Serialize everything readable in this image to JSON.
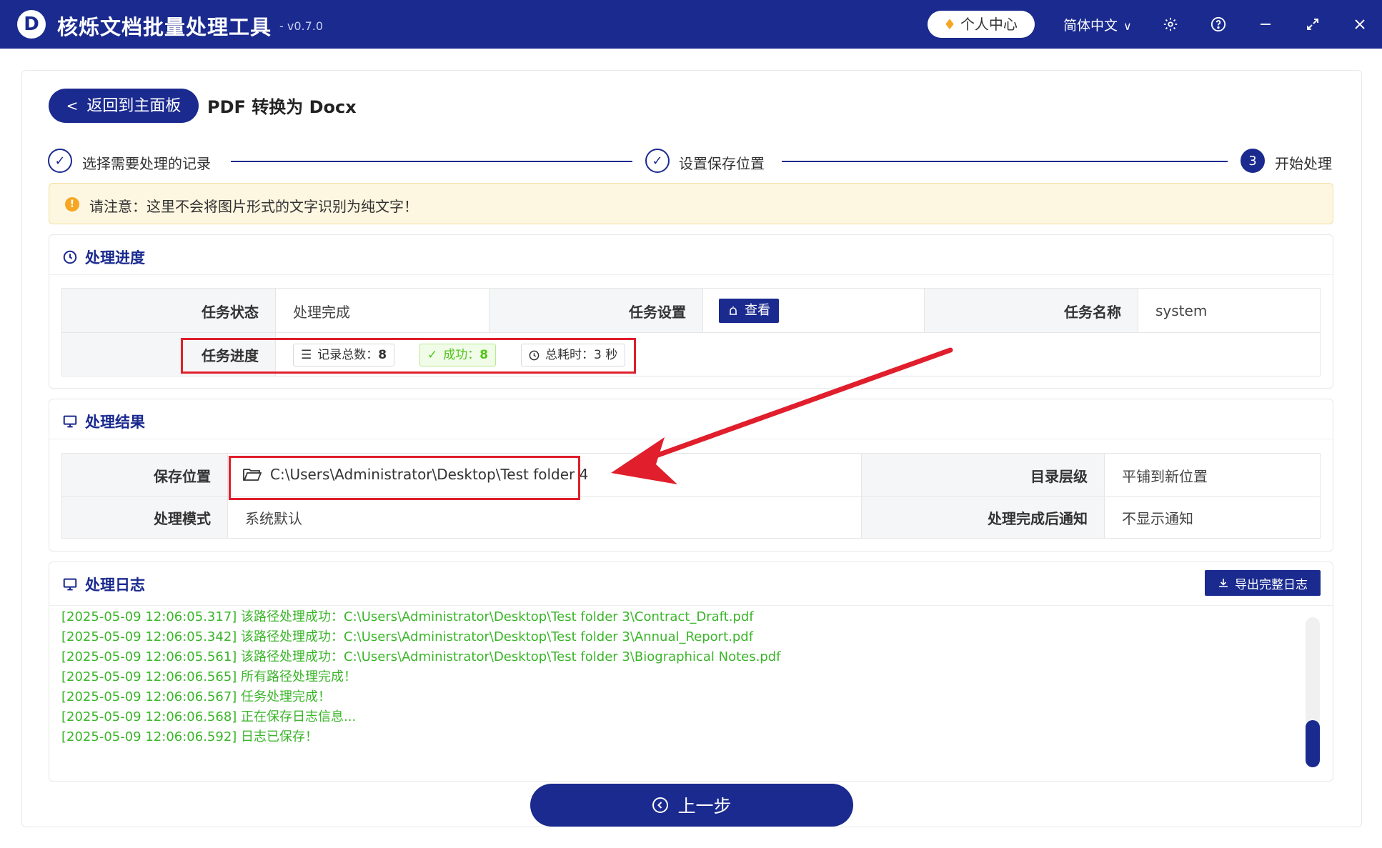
{
  "app": {
    "logo_letter": "D",
    "title": "核烁文档批量处理工具",
    "version": "- v0.7.0",
    "user_center": "个人中心",
    "language": "简体中文"
  },
  "page": {
    "back_label": "返回到主面板",
    "title": "PDF 转换为 Docx"
  },
  "steps": [
    {
      "label": "选择需要处理的记录",
      "state": "done"
    },
    {
      "label": "设置保存位置",
      "state": "done"
    },
    {
      "label": "开始处理",
      "number": "3",
      "state": "active"
    }
  ],
  "notice": {
    "icon": "!",
    "text": "请注意：这里不会将图片形式的文字识别为纯文字！"
  },
  "progress": {
    "title": "处理进度",
    "status_label": "任务状态",
    "status_value": "处理完成",
    "settings_label": "任务设置",
    "view_button": "查看",
    "name_label": "任务名称",
    "name_value": "system",
    "progress_label": "任务进度",
    "total_label": "记录总数：",
    "total_value": "8",
    "success_label": "成功：",
    "success_value": "8",
    "time_label": "总耗时：3 秒"
  },
  "result": {
    "title": "处理结果",
    "save_label": "保存位置",
    "save_path": "C:\\Users\\Administrator\\Desktop\\Test folder 4",
    "dir_label": "目录层级",
    "dir_value": "平铺到新位置",
    "mode_label": "处理模式",
    "mode_value": "系统默认",
    "notify_label": "处理完成后通知",
    "notify_value": "不显示通知"
  },
  "log": {
    "title": "处理日志",
    "export_button": "导出完整日志",
    "lines": [
      "[2025-05-09 12:06:05.317] 该路径处理成功：C:\\Users\\Administrator\\Desktop\\Test folder 3\\Contract_Draft.pdf",
      "[2025-05-09 12:06:05.342] 该路径处理成功：C:\\Users\\Administrator\\Desktop\\Test folder 3\\Annual_Report.pdf",
      "[2025-05-09 12:06:05.561] 该路径处理成功：C:\\Users\\Administrator\\Desktop\\Test folder 3\\Biographical Notes.pdf",
      "[2025-05-09 12:06:06.565] 所有路径处理完成！",
      "[2025-05-09 12:06:06.567] 任务处理完成！",
      "[2025-05-09 12:06:06.568] 正在保存日志信息...",
      "[2025-05-09 12:06:06.592] 日志已保存！"
    ],
    "scroll_position": 0.85
  },
  "footer": {
    "prev_button": "上一步"
  },
  "colors": {
    "primary": "#1a2a8f",
    "success": "#52c41a",
    "log_text": "#3bb52a",
    "highlight": "#e01e2c",
    "notice_bg": "#fdf6e0"
  }
}
